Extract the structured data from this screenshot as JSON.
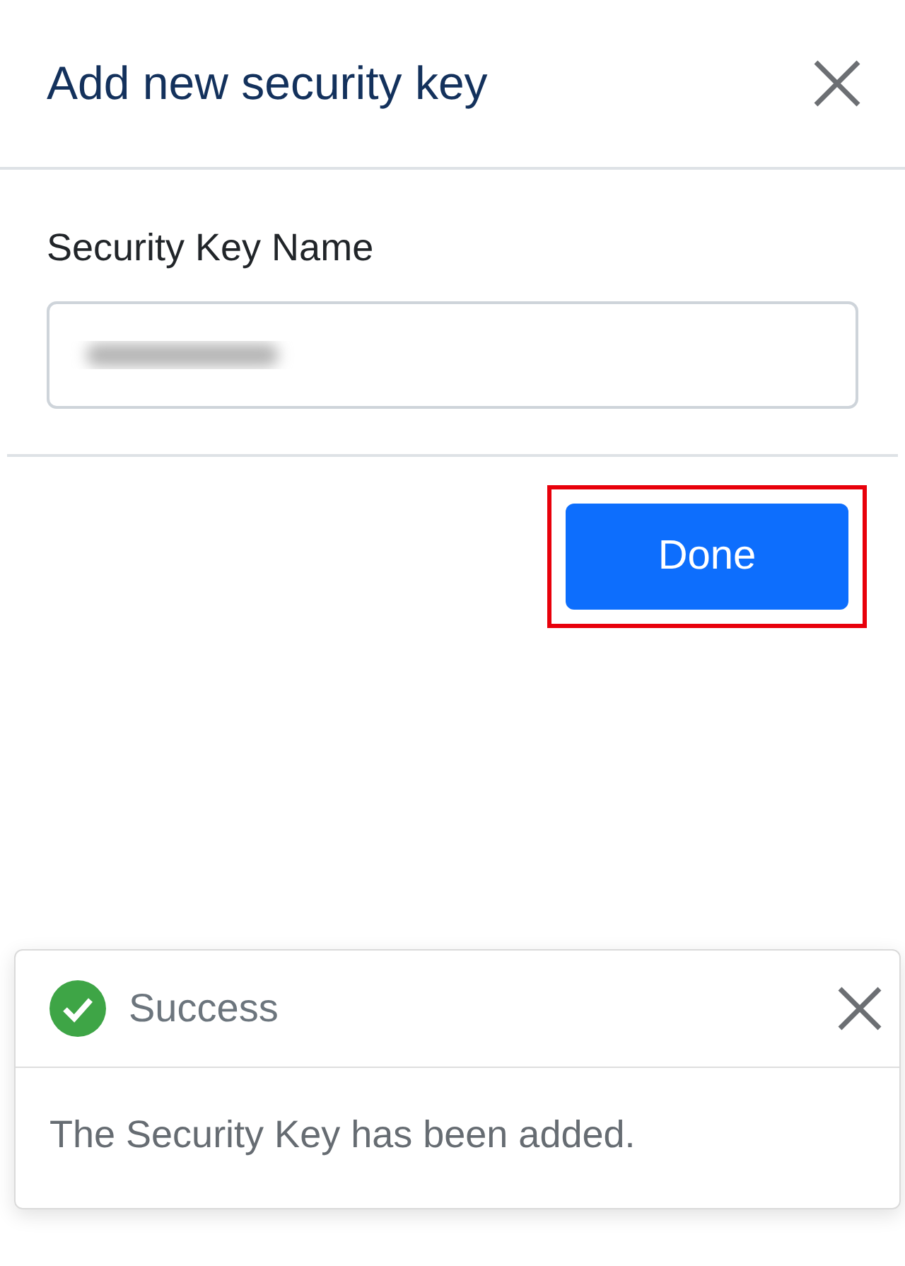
{
  "dialog": {
    "title": "Add new security key",
    "field": {
      "label": "Security Key Name",
      "value_redacted": true
    },
    "button": {
      "label": "Done",
      "highlighted": true
    }
  },
  "toast": {
    "title": "Success",
    "message": "The Security Key has been added."
  }
}
